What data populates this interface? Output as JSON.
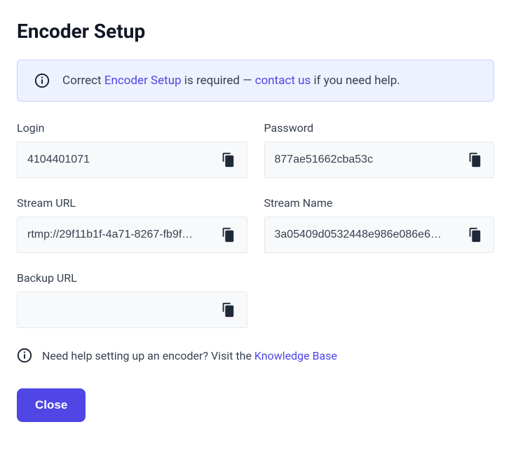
{
  "title": "Encoder Setup",
  "banner": {
    "text_before": "Correct ",
    "link1": "Encoder Setup",
    "text_mid": " is required — ",
    "link2": "contact us",
    "text_after": " if you need help."
  },
  "fields": {
    "login": {
      "label": "Login",
      "value": "4104401071"
    },
    "password": {
      "label": "Password",
      "value": "877ae51662cba53c"
    },
    "stream_url": {
      "label": "Stream URL",
      "value": "rtmp://29f11b1f-4a71-8267-fb9f…"
    },
    "stream_name": {
      "label": "Stream Name",
      "value": "3a05409d0532448e986e086e6…"
    },
    "backup_url": {
      "label": "Backup URL",
      "value": ""
    }
  },
  "help": {
    "text": "Need help setting up an encoder? Visit the ",
    "link": "Knowledge Base"
  },
  "buttons": {
    "close": "Close"
  }
}
